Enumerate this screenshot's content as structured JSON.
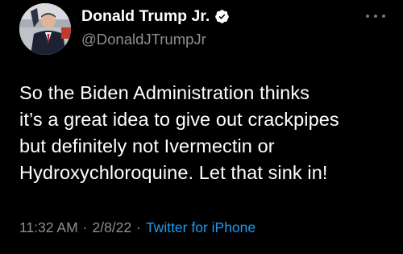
{
  "author": {
    "display_name": "Donald Trump Jr.",
    "handle": "@DonaldJTrumpJr",
    "verified": true
  },
  "tweet": {
    "lines": [
      "So the Biden Administration thinks",
      "it’s a great idea to give out crackpipes",
      "but definitely not Ivermectin or",
      "Hydroxychloroquine. Let that sink in!"
    ]
  },
  "meta": {
    "time": "11:32 AM",
    "date": "2/8/22",
    "separator": "·",
    "source": "Twitter for iPhone"
  },
  "icons": {
    "verified": "verified-badge-icon",
    "more": "more-options-icon"
  },
  "colors": {
    "background": "#000000",
    "text": "#ffffff",
    "secondary": "#8b9095",
    "link": "#1d9bf0",
    "verified": "#1d9bf0"
  }
}
